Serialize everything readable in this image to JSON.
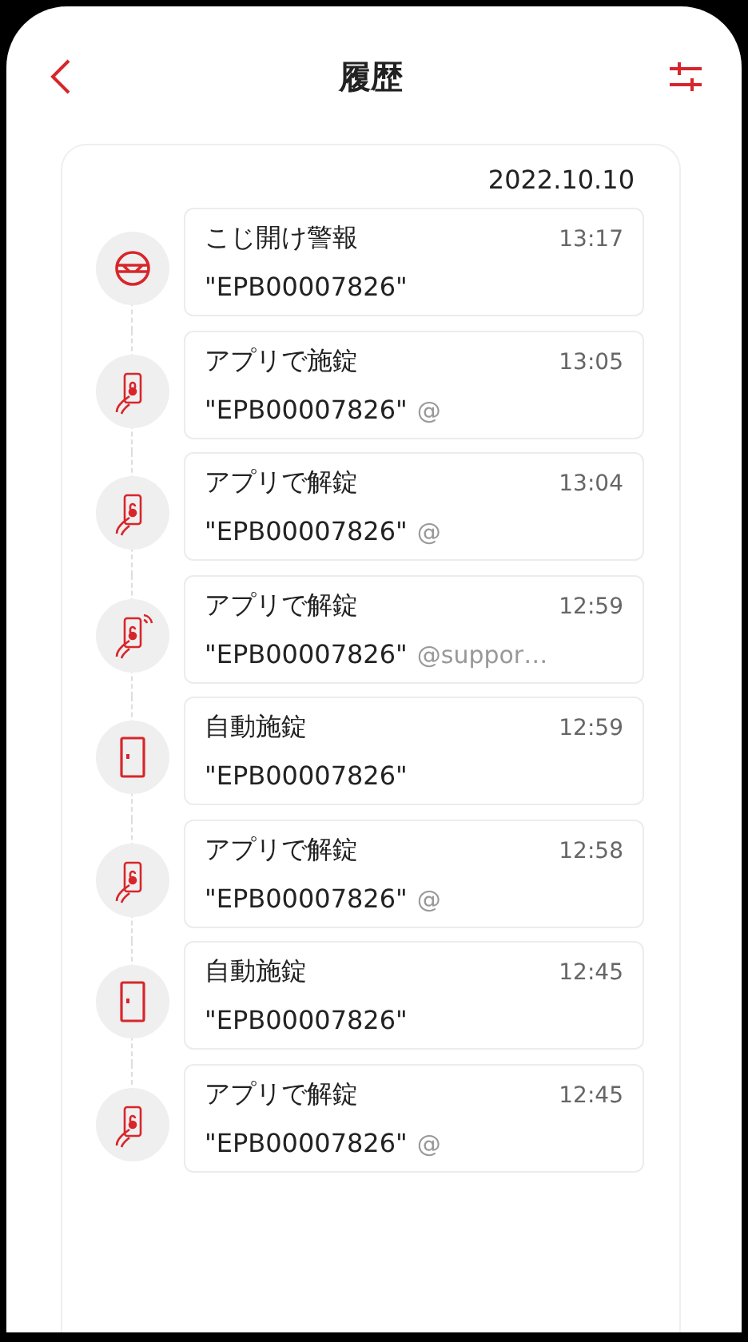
{
  "header": {
    "title": "履歴"
  },
  "date": "2022.10.10",
  "events": [
    {
      "kind": "alarm",
      "title": "こじ開け警報",
      "time": "13:17",
      "device": "\"EPB00007826\""
    },
    {
      "kind": "app_lock",
      "title": "アプリで施錠",
      "time": "13:05",
      "device": "\"EPB00007826\"",
      "user": "@"
    },
    {
      "kind": "app_unlock",
      "title": "アプリで解錠",
      "time": "13:04",
      "device": "\"EPB00007826\"",
      "user": "@"
    },
    {
      "kind": "remote_unlock",
      "title": "アプリで解錠",
      "time": "12:59",
      "device": "\"EPB00007826\"",
      "user": "@suppor…"
    },
    {
      "kind": "auto_lock",
      "title": "自動施錠",
      "time": "12:59",
      "device": "\"EPB00007826\""
    },
    {
      "kind": "app_unlock",
      "title": "アプリで解錠",
      "time": "12:58",
      "device": "\"EPB00007826\"",
      "user": "@"
    },
    {
      "kind": "auto_lock",
      "title": "自動施錠",
      "time": "12:45",
      "device": "\"EPB00007826\""
    },
    {
      "kind": "app_unlock",
      "title": "アプリで解錠",
      "time": "12:45",
      "device": "\"EPB00007826\"",
      "user": "@"
    }
  ]
}
